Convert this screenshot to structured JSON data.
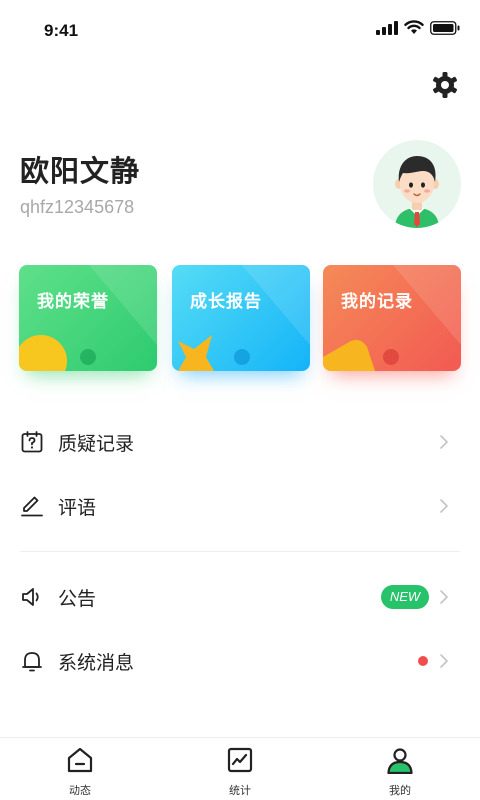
{
  "status_bar": {
    "time": "9:41",
    "icons": [
      "signal-icon",
      "wifi-icon",
      "battery-icon"
    ]
  },
  "header": {
    "settings_icon": "gear-icon"
  },
  "profile": {
    "name": "欧阳文静",
    "account": "qhfz12345678",
    "avatar_icon": "boy-avatar"
  },
  "cards": [
    {
      "label": "我的荣誉",
      "color": "#2ecb6f"
    },
    {
      "label": "成长报告",
      "color": "#14b4f8"
    },
    {
      "label": "我的记录",
      "color": "#f25a52"
    }
  ],
  "menu": [
    {
      "label": "质疑记录",
      "icon": "question-calendar-icon"
    },
    {
      "label": "评语",
      "icon": "pen-icon"
    },
    {
      "label": "公告",
      "icon": "speaker-icon",
      "badge": "NEW"
    },
    {
      "label": "系统消息",
      "icon": "bell-icon",
      "unread_dot": true
    }
  ],
  "tabs": [
    {
      "label": "动态",
      "icon": "home-icon"
    },
    {
      "label": "统计",
      "icon": "chart-icon"
    },
    {
      "label": "我的",
      "icon": "person-icon",
      "active": true
    }
  ],
  "colors": {
    "accent": "#27c26a",
    "alert": "#f04e4e",
    "text": "#222222",
    "muted": "#a8a8a8"
  }
}
